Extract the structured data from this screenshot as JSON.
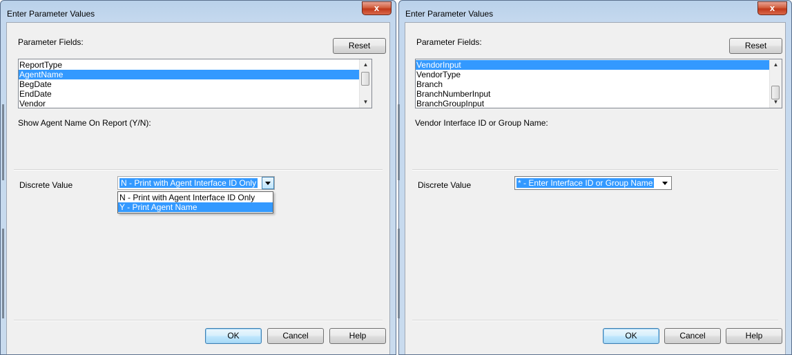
{
  "colors": {
    "selection": "#3399ff",
    "dialog_bg": "#f0f0f0",
    "frame": "#c4d8ee",
    "close_button": "#c0391b"
  },
  "left_dialog": {
    "title": "Enter Parameter Values",
    "close_icon": "close-icon",
    "close_glyph": "x",
    "param_fields_label": "Parameter Fields:",
    "reset_label": "Reset",
    "fields": [
      {
        "label": "ReportType",
        "selected": false
      },
      {
        "label": "AgentName",
        "selected": true
      },
      {
        "label": "BegDate",
        "selected": false
      },
      {
        "label": "EndDate",
        "selected": false
      },
      {
        "label": "Vendor",
        "selected": false
      }
    ],
    "prompt": "Show Agent Name On Report (Y/N):",
    "discrete_label": "Discrete Value",
    "discrete_value": "N - Print with Agent Interface ID Only",
    "options": [
      {
        "label": "N - Print with Agent Interface ID Only",
        "selected": false
      },
      {
        "label": "Y - Print Agent Name",
        "selected": true
      }
    ],
    "ok_label": "OK",
    "cancel_label": "Cancel",
    "help_label": "Help"
  },
  "right_dialog": {
    "title": "Enter Parameter Values",
    "close_icon": "close-icon",
    "close_glyph": "x",
    "param_fields_label": "Parameter Fields:",
    "reset_label": "Reset",
    "fields": [
      {
        "label": "VendorInput",
        "selected": true
      },
      {
        "label": "VendorType",
        "selected": false
      },
      {
        "label": "Branch",
        "selected": false
      },
      {
        "label": "BranchNumberInput",
        "selected": false
      },
      {
        "label": "BranchGroupInput",
        "selected": false
      }
    ],
    "prompt": "Vendor Interface ID or Group Name:",
    "discrete_label": "Discrete Value",
    "discrete_value": "* - Enter Interface ID or Group Name",
    "ok_label": "OK",
    "cancel_label": "Cancel",
    "help_label": "Help"
  }
}
